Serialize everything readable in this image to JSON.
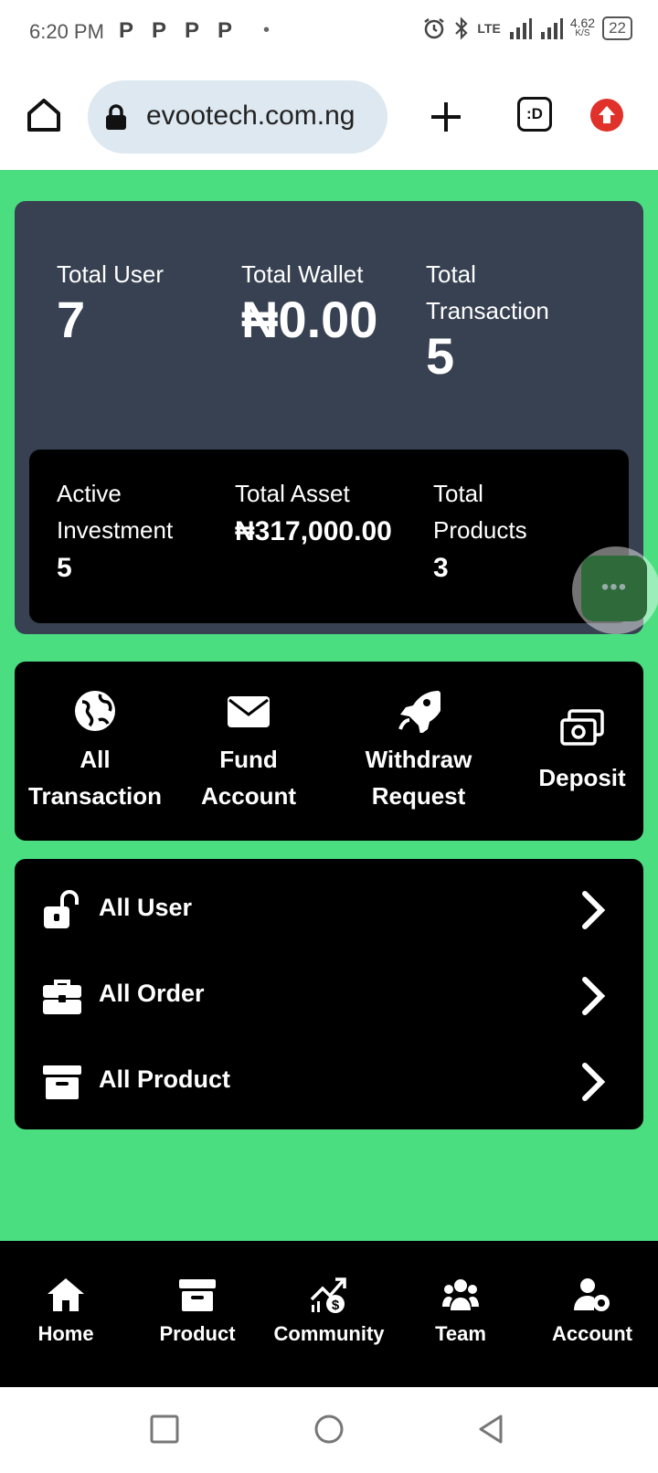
{
  "status_bar": {
    "time": "6:20 PM",
    "notification_icons": [
      "P",
      "P",
      "P",
      "P"
    ],
    "network": "LTE",
    "speed": "4.62",
    "speed_unit": "K/S",
    "battery": "22"
  },
  "browser": {
    "url": "evootech.com.ng",
    "tabs_label": ":D"
  },
  "stats": {
    "total_user_label": "Total User",
    "total_user_value": "7",
    "total_wallet_label": "Total Wallet",
    "total_wallet_value": "₦0.00",
    "total_transaction_label_1": "Total",
    "total_transaction_label_2": "Transaction",
    "total_transaction_value": "5",
    "active_investment_label_1": "Active",
    "active_investment_label_2": "Investment",
    "active_investment_value": "5",
    "total_asset_label": "Total Asset",
    "total_asset_value": "₦317,000.00",
    "total_products_label_1": "Total",
    "total_products_label_2": "Products",
    "total_products_value": "3"
  },
  "fab_label": "•••",
  "actions": {
    "all_transaction_1": "All",
    "all_transaction_2": "Transaction",
    "fund_account_1": "Fund",
    "fund_account_2": "Account",
    "withdraw_request_1": "Withdraw",
    "withdraw_request_2": "Request",
    "deposit": "Deposit"
  },
  "menu": {
    "all_user": "All User",
    "all_order": "All Order",
    "all_product": "All Product"
  },
  "bottom_nav": {
    "home": "Home",
    "product": "Product",
    "community": "Community",
    "team": "Team",
    "account": "Account"
  }
}
